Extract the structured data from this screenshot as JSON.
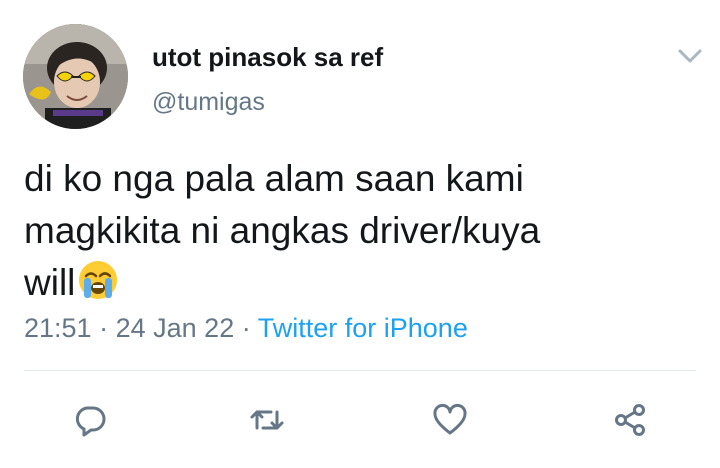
{
  "author": {
    "display_name": "utot pinasok sa ref",
    "handle": "@tumigas",
    "avatar": "profile-photo"
  },
  "menu_icon": "chevron-down-icon",
  "tweet": {
    "text": "di ko nga pala alam saan kami\nmagkikita ni angkas driver/kuya\nwill",
    "emoji": "loudly-crying-face"
  },
  "meta": {
    "time": "21:51",
    "separator": "·",
    "date": "24 Jan 22",
    "source": "Twitter for iPhone"
  },
  "actions": {
    "reply_icon": "reply-icon",
    "retweet_icon": "retweet-icon",
    "like_icon": "heart-icon",
    "share_icon": "share-icon"
  },
  "colors": {
    "primary_text": "#14171a",
    "secondary_text": "#657786",
    "link": "#1da1f2",
    "divider": "#e1e8ed"
  }
}
